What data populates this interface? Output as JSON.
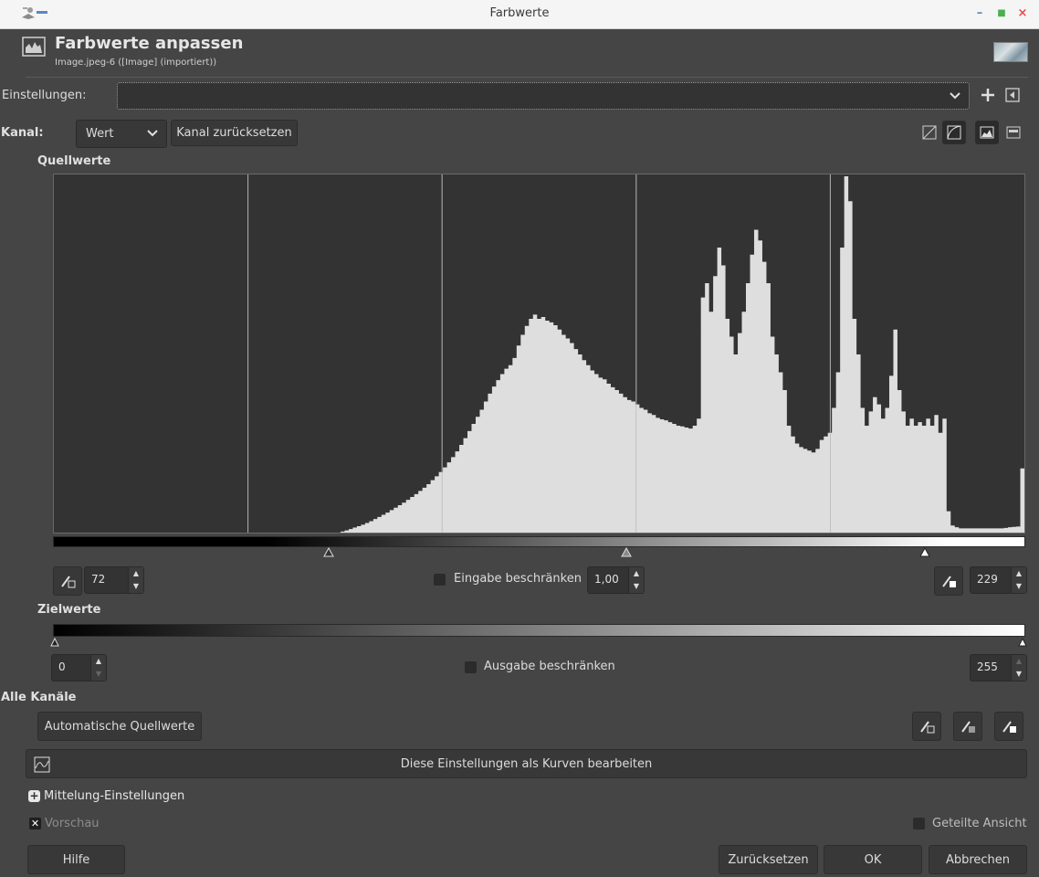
{
  "window": {
    "title": "Farbwerte"
  },
  "header": {
    "title": "Farbwerte anpassen",
    "subtitle": "Image.jpeg-6 ([Image] (importiert))"
  },
  "presets": {
    "label": "Einstellungen:",
    "value": ""
  },
  "channel": {
    "label": "Kanal:",
    "value": "Wert",
    "reset_label": "Kanal zurücksetzen"
  },
  "input_levels": {
    "section_label": "Quellwerte",
    "low": "72",
    "gamma": "1,00",
    "high": "229",
    "clamp_label": "Eingabe beschränken"
  },
  "output_levels": {
    "section_label": "Zielwerte",
    "low": "0",
    "high": "255",
    "clamp_label": "Ausgabe beschränken"
  },
  "all_channels": {
    "section_label": "Alle Kanäle",
    "auto_label": "Automatische Quellwerte"
  },
  "curves_button": {
    "label": "Diese Einstellungen als Kurven bearbeiten"
  },
  "blending": {
    "label": "Mittelung-Einstellungen"
  },
  "preview": {
    "label": "Vorschau",
    "checked": true
  },
  "split_view": {
    "label": "Geteilte Ansicht",
    "checked": false
  },
  "footer": {
    "help": "Hilfe",
    "reset": "Zurücksetzen",
    "ok": "OK",
    "cancel": "Abbrechen"
  },
  "colors": {
    "bg": "#454545",
    "hist_bg": "#333333",
    "hist_fill": "#dedede",
    "accent": "#5b86c5"
  },
  "histogram": {
    "values": [
      0,
      0,
      0,
      0,
      0,
      0,
      0,
      0,
      0,
      0,
      0,
      0,
      0,
      0,
      0,
      0,
      0,
      0,
      0,
      0,
      0,
      0,
      0,
      0,
      0,
      0,
      0,
      0,
      0,
      0,
      0,
      0,
      0,
      0,
      0,
      0,
      0,
      0,
      0,
      0,
      0,
      0,
      0,
      0,
      0,
      0,
      0,
      0,
      0,
      0,
      0,
      0,
      0,
      0,
      0,
      0,
      0,
      0,
      0,
      0,
      0,
      0,
      0,
      0,
      0,
      0,
      0,
      0,
      0,
      0,
      0.003,
      0.006,
      0.01,
      0.014,
      0.018,
      0.022,
      0.027,
      0.032,
      0.038,
      0.044,
      0.05,
      0.056,
      0.063,
      0.07,
      0.077,
      0.084,
      0.092,
      0.1,
      0.108,
      0.117,
      0.126,
      0.136,
      0.147,
      0.158,
      0.17,
      0.183,
      0.197,
      0.212,
      0.228,
      0.246,
      0.265,
      0.285,
      0.305,
      0.325,
      0.345,
      0.368,
      0.39,
      0.41,
      0.428,
      0.445,
      0.46,
      0.47,
      0.49,
      0.525,
      0.555,
      0.58,
      0.6,
      0.612,
      0.6,
      0.605,
      0.595,
      0.59,
      0.582,
      0.57,
      0.555,
      0.545,
      0.532,
      0.515,
      0.5,
      0.484,
      0.47,
      0.455,
      0.445,
      0.435,
      0.43,
      0.418,
      0.408,
      0.4,
      0.39,
      0.38,
      0.372,
      0.368,
      0.36,
      0.35,
      0.345,
      0.335,
      0.33,
      0.322,
      0.318,
      0.315,
      0.31,
      0.305,
      0.3,
      0.298,
      0.295,
      0.292,
      0.3,
      0.32,
      0.66,
      0.7,
      0.62,
      0.72,
      0.8,
      0.75,
      0.6,
      0.55,
      0.5,
      0.56,
      0.62,
      0.7,
      0.78,
      0.85,
      0.82,
      0.76,
      0.7,
      0.55,
      0.5,
      0.45,
      0.4,
      0.3,
      0.27,
      0.25,
      0.24,
      0.235,
      0.23,
      0.225,
      0.235,
      0.26,
      0.27,
      0.28,
      0.35,
      0.45,
      0.8,
      1.0,
      0.93,
      0.6,
      0.5,
      0.35,
      0.3,
      0.34,
      0.38,
      0.36,
      0.32,
      0.35,
      0.44,
      0.57,
      0.4,
      0.34,
      0.3,
      0.32,
      0.3,
      0.31,
      0.3,
      0.32,
      0.3,
      0.33,
      0.28,
      0.32,
      0.06,
      0.02,
      0.015,
      0.012,
      0.012,
      0.012,
      0.012,
      0.012,
      0.012,
      0.012,
      0.012,
      0.012,
      0.012,
      0.012,
      0.013,
      0.015,
      0.016,
      0.017,
      0.18
    ]
  }
}
